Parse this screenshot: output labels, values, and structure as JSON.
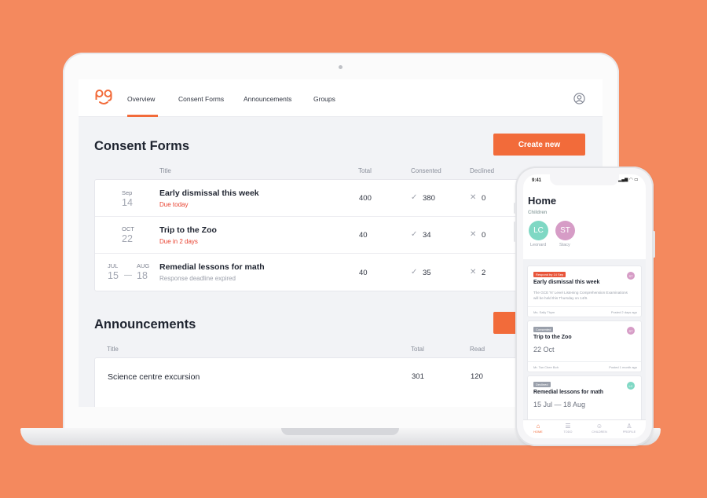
{
  "nav": {
    "items": [
      "Overview",
      "Consent Forms",
      "Announcements",
      "Groups"
    ],
    "active": "Overview"
  },
  "consent": {
    "heading": "Consent Forms",
    "create_label": "Create new",
    "columns": {
      "title": "Title",
      "total": "Total",
      "consented": "Consented",
      "declined": "Declined"
    },
    "rows": [
      {
        "mon1": "Sep",
        "day1": "14",
        "title": "Early dismissal this week",
        "sub": "Due today",
        "total": "400",
        "consented": "380",
        "declined": "0"
      },
      {
        "mon1": "OCT",
        "day1": "22",
        "title": "Trip to the Zoo",
        "sub": "Due in 2 days",
        "total": "40",
        "consented": "34",
        "declined": "0"
      },
      {
        "mon1": "JUL",
        "day1": "15",
        "mon2": "AUG",
        "day2": "18",
        "title": "Remedial lessons for math",
        "sub": "Response deadline expired",
        "total": "40",
        "consented": "35",
        "declined": "2"
      }
    ]
  },
  "announcements": {
    "heading": "Announcements",
    "columns": {
      "title": "Title",
      "total": "Total",
      "read": "Read"
    },
    "rows": [
      {
        "title": "Science centre excursion",
        "total": "301",
        "read": "120"
      }
    ]
  },
  "phone": {
    "time": "9:41",
    "title": "Home",
    "children_label": "Children",
    "children": [
      {
        "initials": "LC",
        "name": "Leonard",
        "color": "#7FD8C4"
      },
      {
        "initials": "ST",
        "name": "Stacy",
        "color": "#D69CC6"
      }
    ],
    "cards": [
      {
        "badge": "Respond by 14 Sep",
        "badge_color": "#E8553A",
        "title": "Early dismissal this week",
        "desc": "The GCE 'N' Level Listening Comprehension Examinations will be held this Thursday on 14/9.",
        "from": "Ms. Sally Thym",
        "posted": "Posted 2 days ago"
      },
      {
        "badge": "Consented",
        "badge_color": "#9aa0ab",
        "title": "Trip to the Zoo",
        "date": "22 Oct",
        "from": "Mr. Tan Chee Boh",
        "posted": "Posted 1 month ago"
      },
      {
        "badge": "Declined",
        "badge_color": "#9aa0ab",
        "title": "Remedial lessons for math",
        "date": "15 Jul — 18 Aug"
      }
    ],
    "tabs": [
      "HOME",
      "TODO",
      "CHILDREN",
      "PROFILE"
    ]
  }
}
